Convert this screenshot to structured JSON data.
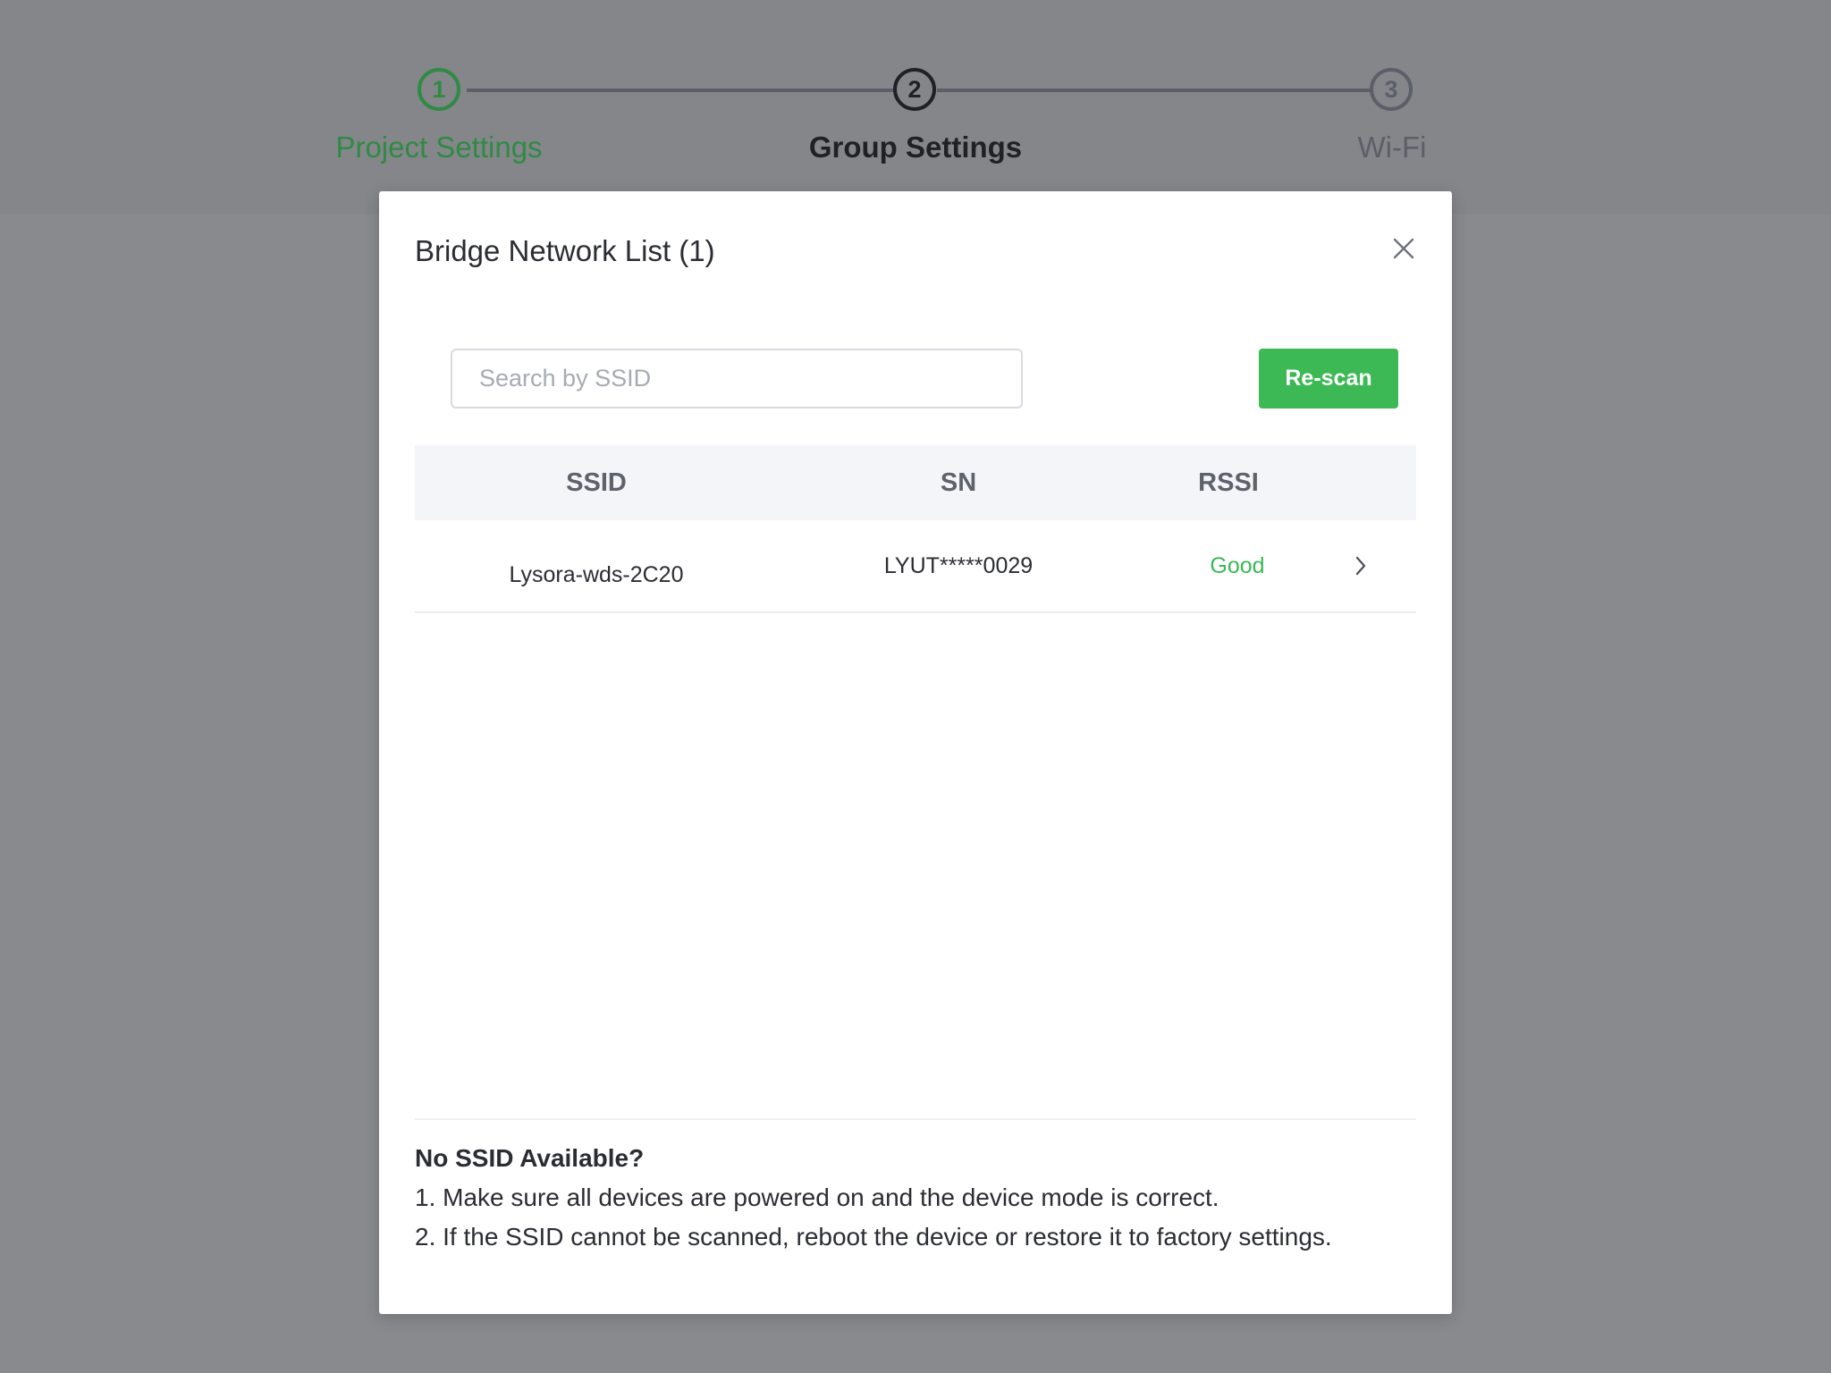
{
  "stepper": {
    "steps": [
      {
        "number": "1",
        "label": "Project Settings",
        "state": "completed"
      },
      {
        "number": "2",
        "label": "Group Settings",
        "state": "active"
      },
      {
        "number": "3",
        "label": "Wi-Fi",
        "state": "pending"
      }
    ]
  },
  "modal": {
    "title": "Bridge Network List (1)",
    "close_icon": "close-icon",
    "search": {
      "placeholder": "Search by SSID",
      "value": ""
    },
    "rescan_label": "Re-scan",
    "table": {
      "columns": [
        "SSID",
        "SN",
        "RSSI"
      ],
      "rows": [
        {
          "ssid": "Lysora-wds-2C20",
          "sn": "LYUT*****0029",
          "rssi": "Good"
        }
      ]
    },
    "help": {
      "title": "No SSID Available?",
      "lines": [
        "1. Make sure all devices are powered on and the device mode is correct.",
        "2. If the SSID cannot be scanned, reboot the device or restore it to factory settings."
      ]
    }
  },
  "colors": {
    "accent_green": "#3cb954",
    "completed_green": "#2f8a45",
    "active_dark": "#1f2126",
    "pending_gray": "#5b5f68"
  }
}
